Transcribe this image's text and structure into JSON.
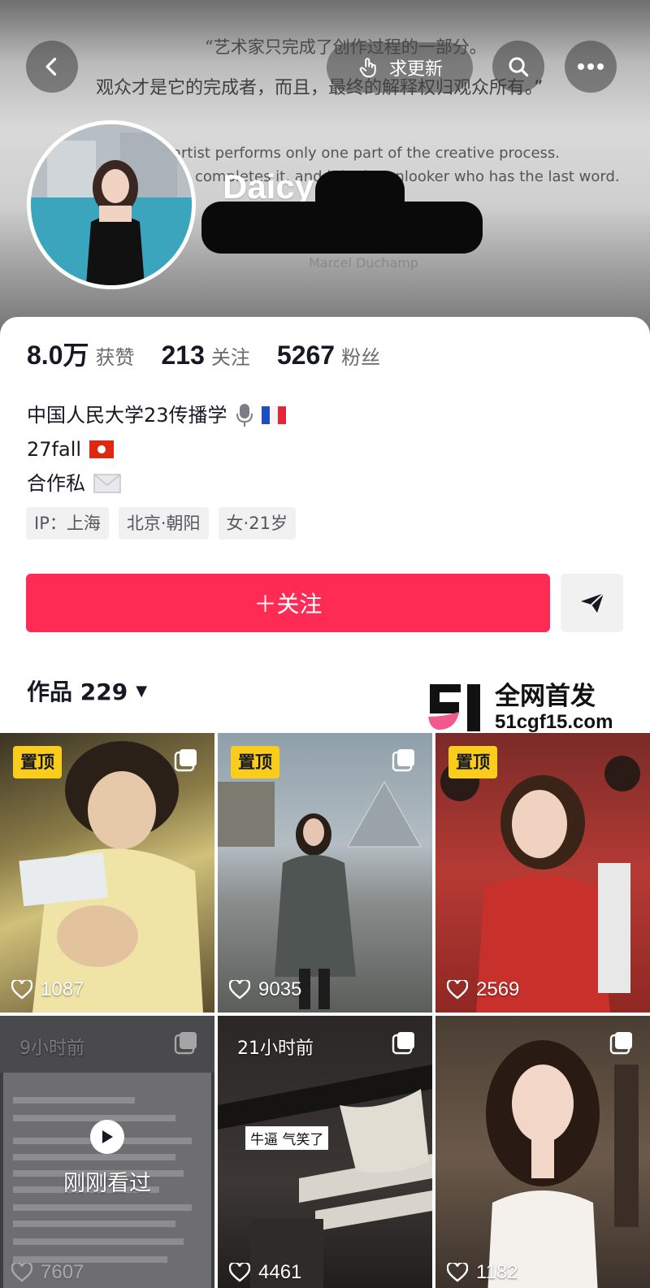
{
  "header": {
    "quote_cn_1": "“艺术家只完成了创作过程的一部分。",
    "quote_cn_2": "观众才是它的完成者，而且，最终的解释权归观众所有。”",
    "quote_en_1": "artist performs only one part of the creative process.",
    "quote_en_2": "completes it, and it is the onlooker who has the last word.",
    "quote_author": "Marcel Duchamp",
    "update_label": "求更新",
    "back_icon": "chevron-left-icon",
    "search_icon": "search-icon",
    "more_icon": "more-horizontal-icon"
  },
  "profile": {
    "username": "Daicy",
    "likes_count": "8.0万",
    "likes_label": "获赞",
    "following_count": "213",
    "following_label": "关注",
    "followers_count": "5267",
    "followers_label": "粉丝",
    "bio_lines": [
      "中国人民大学23传播学",
      "27fall",
      "合作私"
    ],
    "tags": [
      "IP：上海",
      "北京·朝阳",
      "女·21岁"
    ],
    "follow_label": "＋关注",
    "works_label": "作品 229"
  },
  "watermark": {
    "cn": "全网首发",
    "url": "51cgf15.com"
  },
  "colors": {
    "accent": "#fe2c55",
    "pin": "#facd1d",
    "text": "#161823"
  },
  "videos": [
    {
      "badge": "置顶",
      "likes": "1087"
    },
    {
      "badge": "置顶",
      "likes": "9035"
    },
    {
      "badge": "置顶",
      "likes": "2569"
    },
    {
      "time": "9小时前",
      "overlay": "刚刚看过",
      "likes": "7607"
    },
    {
      "time": "21小时前",
      "caption": "牛逼 气笑了",
      "likes": "4461"
    },
    {
      "likes": "1182"
    }
  ]
}
